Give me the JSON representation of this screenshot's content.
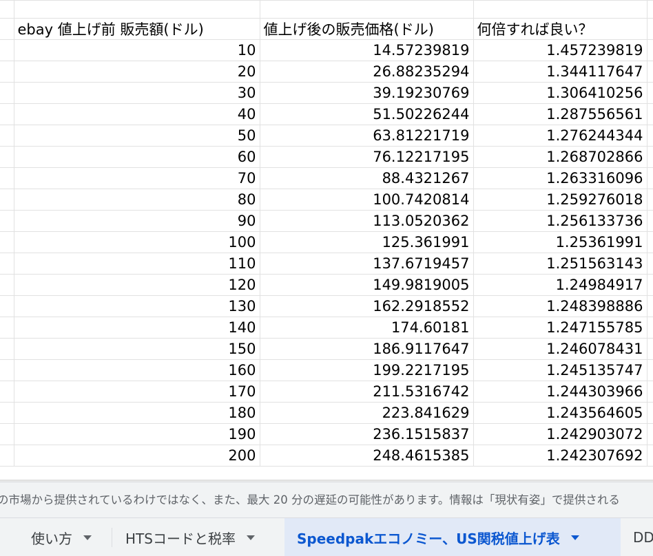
{
  "sheet": {
    "headers": [
      "ebay 値上げ前 販売額(ドル)",
      "値上げ後の販売価格(ドル)",
      "何倍すれば良い？"
    ],
    "rows": [
      [
        "10",
        "14.57239819",
        "1.457239819"
      ],
      [
        "20",
        "26.88235294",
        "1.344117647"
      ],
      [
        "30",
        "39.19230769",
        "1.306410256"
      ],
      [
        "40",
        "51.50226244",
        "1.287556561"
      ],
      [
        "50",
        "63.81221719",
        "1.276244344"
      ],
      [
        "60",
        "76.12217195",
        "1.268702866"
      ],
      [
        "70",
        "88.4321267",
        "1.263316096"
      ],
      [
        "80",
        "100.7420814",
        "1.259276018"
      ],
      [
        "90",
        "113.0520362",
        "1.256133736"
      ],
      [
        "100",
        "125.361991",
        "1.25361991"
      ],
      [
        "110",
        "137.6719457",
        "1.251563143"
      ],
      [
        "120",
        "149.9819005",
        "1.24984917"
      ],
      [
        "130",
        "162.2918552",
        "1.248398886"
      ],
      [
        "140",
        "174.60181",
        "1.247155785"
      ],
      [
        "150",
        "186.9117647",
        "1.246078431"
      ],
      [
        "160",
        "199.2217195",
        "1.245135747"
      ],
      [
        "170",
        "211.5316742",
        "1.244303966"
      ],
      [
        "180",
        "223.841629",
        "1.243564605"
      ],
      [
        "190",
        "236.1515837",
        "1.242903072"
      ],
      [
        "200",
        "248.4615385",
        "1.242307692"
      ]
    ]
  },
  "footer": {
    "disclaimer": "の市場から提供されているわけではなく、また、最大 20 分の遅延の可能性があります。情報は「現状有姿」で提供される"
  },
  "tabs": [
    {
      "label": "使い方",
      "active": false
    },
    {
      "label": "HTSコードと税率",
      "active": false
    },
    {
      "label": "Speedpakエコノミー、US関税値上げ表",
      "active": true
    },
    {
      "label": "DD",
      "active": false
    }
  ],
  "colors": {
    "grid_line": "#e1e1e1",
    "tab_bar_bg": "#f1f3f4",
    "active_tab_bg": "#e1e9f7",
    "active_tab_text": "#0b57d0",
    "inactive_tab_text": "#3c4043"
  }
}
